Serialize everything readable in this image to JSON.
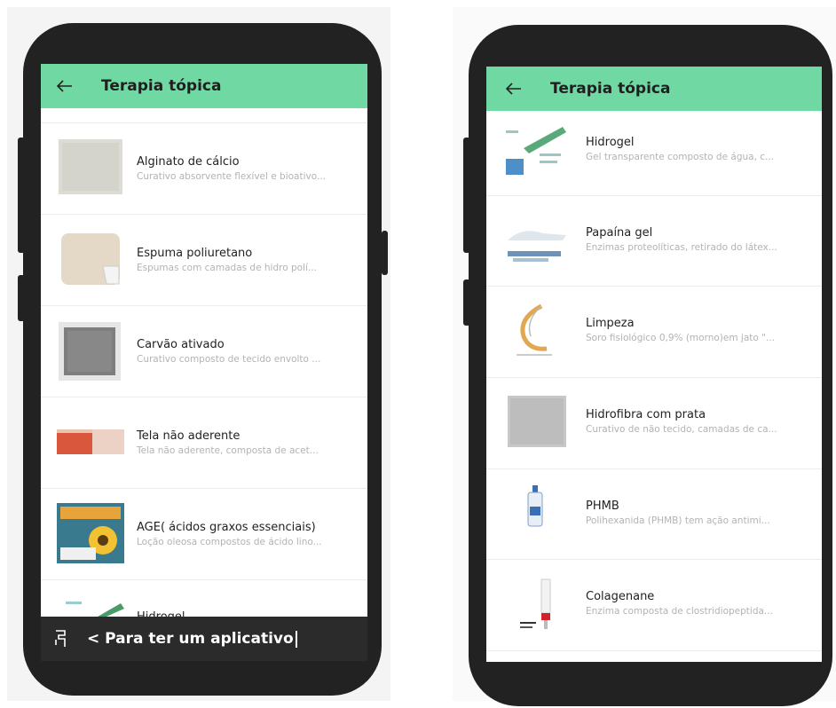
{
  "left_screen": {
    "title": "Terapia tópica",
    "items": [
      {
        "title": "Alginato de cálcio",
        "desc": "Curativo absorvente flexível e bioativo..."
      },
      {
        "title": "Espuma poliuretano",
        "desc": "Espumas com camadas de hidro polí..."
      },
      {
        "title": "Carvão ativado",
        "desc": "Curativo composto de tecido envolto ..."
      },
      {
        "title": "Tela não aderente",
        "desc": "Tela não aderente, composta de acet..."
      },
      {
        "title": "AGE( ácidos graxos essenciais)",
        "desc": "Loção oleosa compostos de ácido lino..."
      },
      {
        "title": "Hidrogel",
        "desc": ""
      }
    ],
    "bottom_bar": {
      "text": "< Para ter um aplicativo",
      "icon": "phone-icon"
    }
  },
  "right_screen": {
    "title": "Terapia tópica",
    "items": [
      {
        "title": "Hidrogel",
        "desc": "Gel transparente composto de água, c..."
      },
      {
        "title": "Papaína gel",
        "desc": "Enzimas proteolíticas, retirado do látex..."
      },
      {
        "title": "Limpeza",
        "desc": "Soro fisiológico 0,9% (morno)em jato \"..."
      },
      {
        "title": "Hidrofibra com prata",
        "desc": "Curativo de não tecido, camadas de ca..."
      },
      {
        "title": "PHMB",
        "desc": "Polihexanida (PHMB) tem ação antimi..."
      },
      {
        "title": "Colagenane",
        "desc": "Enzima composta de clostridiopeptida..."
      }
    ]
  },
  "colors": {
    "appbar": "#6fd8a3",
    "phone_frame": "#222222",
    "bottom_bar": "#2b2b2b"
  }
}
